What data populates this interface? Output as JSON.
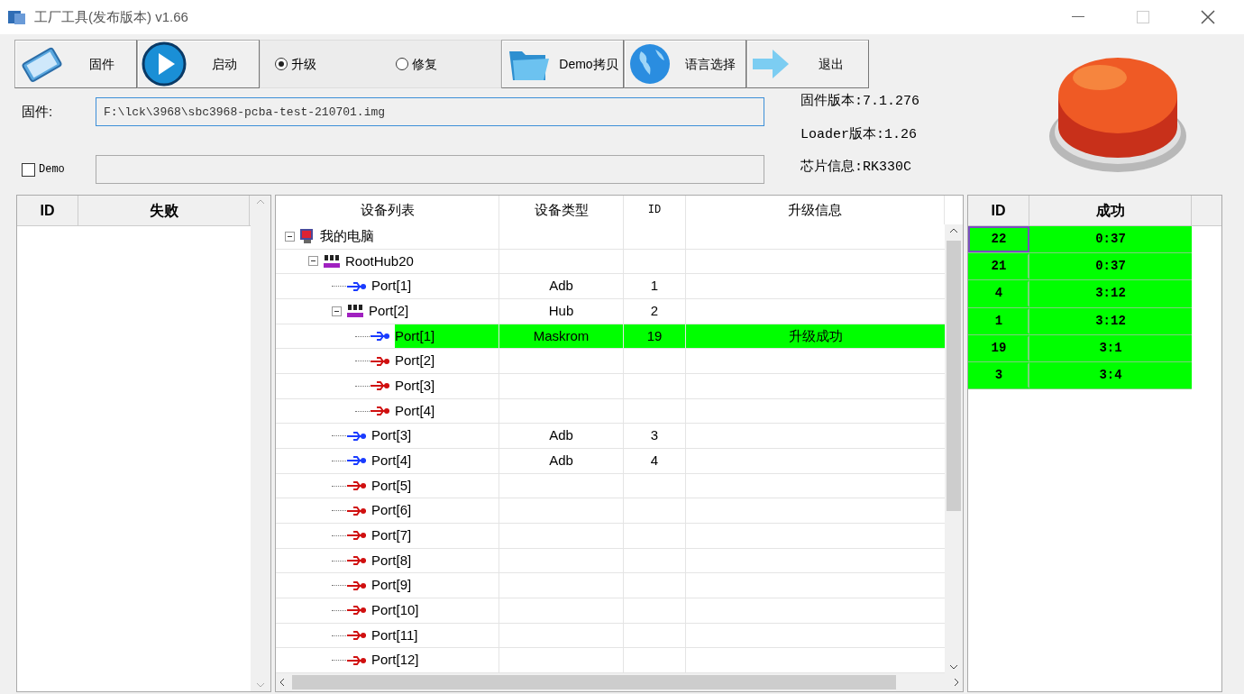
{
  "window": {
    "title": "工厂工具(发布版本) v1.66"
  },
  "toolbar": [
    {
      "kind": "firmware",
      "label": "固件"
    },
    {
      "kind": "start",
      "label": "启动"
    },
    {
      "kind": "radios",
      "options": [
        {
          "label": "升级",
          "selected": true
        },
        {
          "label": "修复",
          "selected": false
        }
      ]
    },
    {
      "kind": "folder",
      "label": "Demo拷贝"
    },
    {
      "kind": "globe",
      "label": "语言选择"
    },
    {
      "kind": "arrow",
      "label": "退出"
    }
  ],
  "firmware_field": {
    "label": "固件:",
    "value": "F:\\lck\\3968\\sbc3968-pcba-test-210701.img"
  },
  "demo": {
    "label": "Demo",
    "checked": false
  },
  "info": [
    "固件版本:7.1.276",
    "Loader版本:1.26",
    "芯片信息:RK330C"
  ],
  "fail_table": {
    "columns": [
      "ID",
      "失败"
    ]
  },
  "device_table": {
    "columns": [
      "设备列表",
      "设备类型",
      "ID",
      "升级信息"
    ],
    "tree": [
      {
        "kind": "pc",
        "name": "我的电脑",
        "expanded": true,
        "highlighted": false,
        "children": [
          {
            "kind": "hub",
            "name": "RootHub20",
            "expanded": true,
            "highlighted": false,
            "children": [
              {
                "kind": "usb",
                "name": "Port[1]",
                "connected": true,
                "type": "Adb",
                "id": "1",
                "highlighted": false
              },
              {
                "kind": "hub",
                "name": "Port[2]",
                "type": "Hub",
                "id": "2",
                "expanded": true,
                "highlighted": false,
                "children": [
                  {
                    "kind": "usb",
                    "name": "Port[1]",
                    "connected": true,
                    "type": "Maskrom",
                    "id": "19",
                    "info": "升级成功",
                    "highlighted": true
                  },
                  {
                    "kind": "usb",
                    "name": "Port[2]",
                    "connected": false,
                    "highlighted": false
                  },
                  {
                    "kind": "usb",
                    "name": "Port[3]",
                    "connected": false,
                    "highlighted": false
                  },
                  {
                    "kind": "usb",
                    "name": "Port[4]",
                    "connected": false,
                    "highlighted": false
                  }
                ]
              },
              {
                "kind": "usb",
                "name": "Port[3]",
                "connected": true,
                "type": "Adb",
                "id": "3",
                "highlighted": false
              },
              {
                "kind": "usb",
                "name": "Port[4]",
                "connected": true,
                "type": "Adb",
                "id": "4",
                "highlighted": false
              },
              {
                "kind": "usb",
                "name": "Port[5]",
                "connected": false,
                "highlighted": false
              },
              {
                "kind": "usb",
                "name": "Port[6]",
                "connected": false,
                "highlighted": false
              },
              {
                "kind": "usb",
                "name": "Port[7]",
                "connected": false,
                "highlighted": false
              },
              {
                "kind": "usb",
                "name": "Port[8]",
                "connected": false,
                "highlighted": false
              },
              {
                "kind": "usb",
                "name": "Port[9]",
                "connected": false,
                "highlighted": false
              },
              {
                "kind": "usb",
                "name": "Port[10]",
                "connected": false,
                "highlighted": false
              },
              {
                "kind": "usb",
                "name": "Port[11]",
                "connected": false,
                "highlighted": false
              },
              {
                "kind": "usb",
                "name": "Port[12]",
                "connected": false,
                "highlighted": false
              }
            ]
          }
        ]
      }
    ]
  },
  "success_table": {
    "columns": [
      "ID",
      "成功"
    ],
    "rows": [
      {
        "id": "22",
        "time": "0:37",
        "selected": true
      },
      {
        "id": "21",
        "time": "0:37",
        "selected": false
      },
      {
        "id": "4",
        "time": "3:12",
        "selected": false
      },
      {
        "id": "1",
        "time": "3:12",
        "selected": false
      },
      {
        "id": "19",
        "time": "3:1",
        "selected": false
      },
      {
        "id": "3",
        "time": "3:4",
        "selected": false
      }
    ]
  }
}
